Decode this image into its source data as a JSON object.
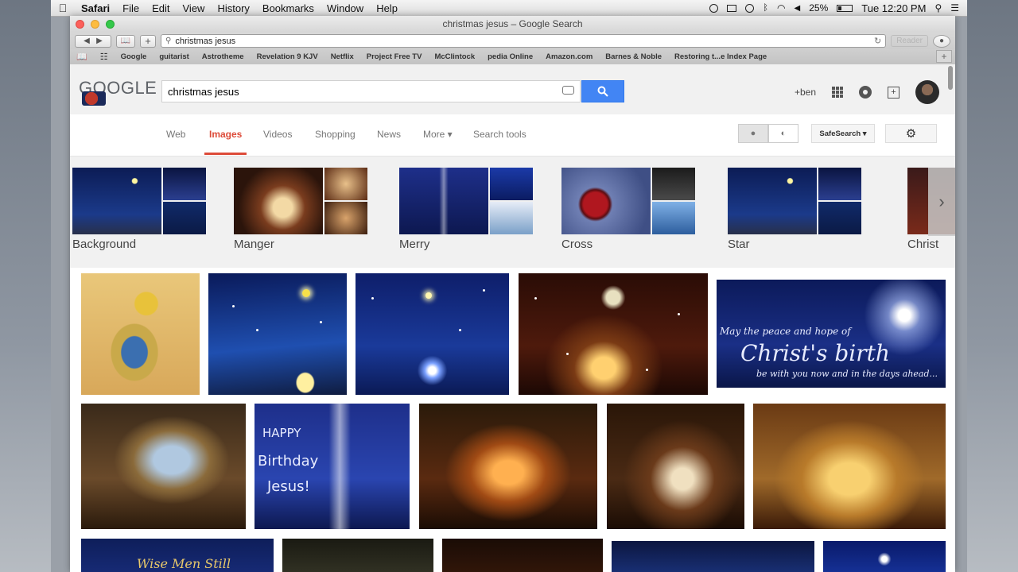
{
  "menubar": {
    "apple": "",
    "items": [
      "Safari",
      "File",
      "Edit",
      "View",
      "History",
      "Bookmarks",
      "Window",
      "Help"
    ],
    "battery": "25%",
    "clock": "Tue 12:20 PM"
  },
  "window": {
    "title": "christmas jesus – Google Search",
    "url": "christmas jesus",
    "reader_label": "Reader"
  },
  "favorites": [
    "Google",
    "guitarist",
    "Astrotheme",
    "Revelation 9 KJV",
    "Netflix",
    "Project Free TV",
    "McClintock",
    "pedia Online",
    "Amazon.com",
    "Barnes & Noble",
    "Restoring t...e Index Page"
  ],
  "google": {
    "logo": "GOOGLE",
    "query": "christmas jesus",
    "user": "+ben",
    "tabs": [
      "Web",
      "Images",
      "Videos",
      "Shopping",
      "News",
      "More ▾",
      "Search tools"
    ],
    "active_tab": "Images",
    "safesearch": "SafeSearch ▾"
  },
  "related": [
    {
      "label": "Background"
    },
    {
      "label": "Manger"
    },
    {
      "label": "Merry"
    },
    {
      "label": "Cross"
    },
    {
      "label": "Star"
    },
    {
      "label": "Christ"
    }
  ],
  "image_texts": {
    "birth_line1": "May the peace and hope of",
    "birth_line2": "Christ's birth",
    "birth_line3": "be with you now and in the days ahead...",
    "hb_line1": "HAPPY",
    "hb_line2": "Birthday",
    "hb_line3": "Jesus!",
    "wise": "Wise Men Still"
  },
  "colors": {
    "accent_red": "#dd4b39",
    "search_blue": "#4285f4",
    "night_blue": "#14285e"
  }
}
